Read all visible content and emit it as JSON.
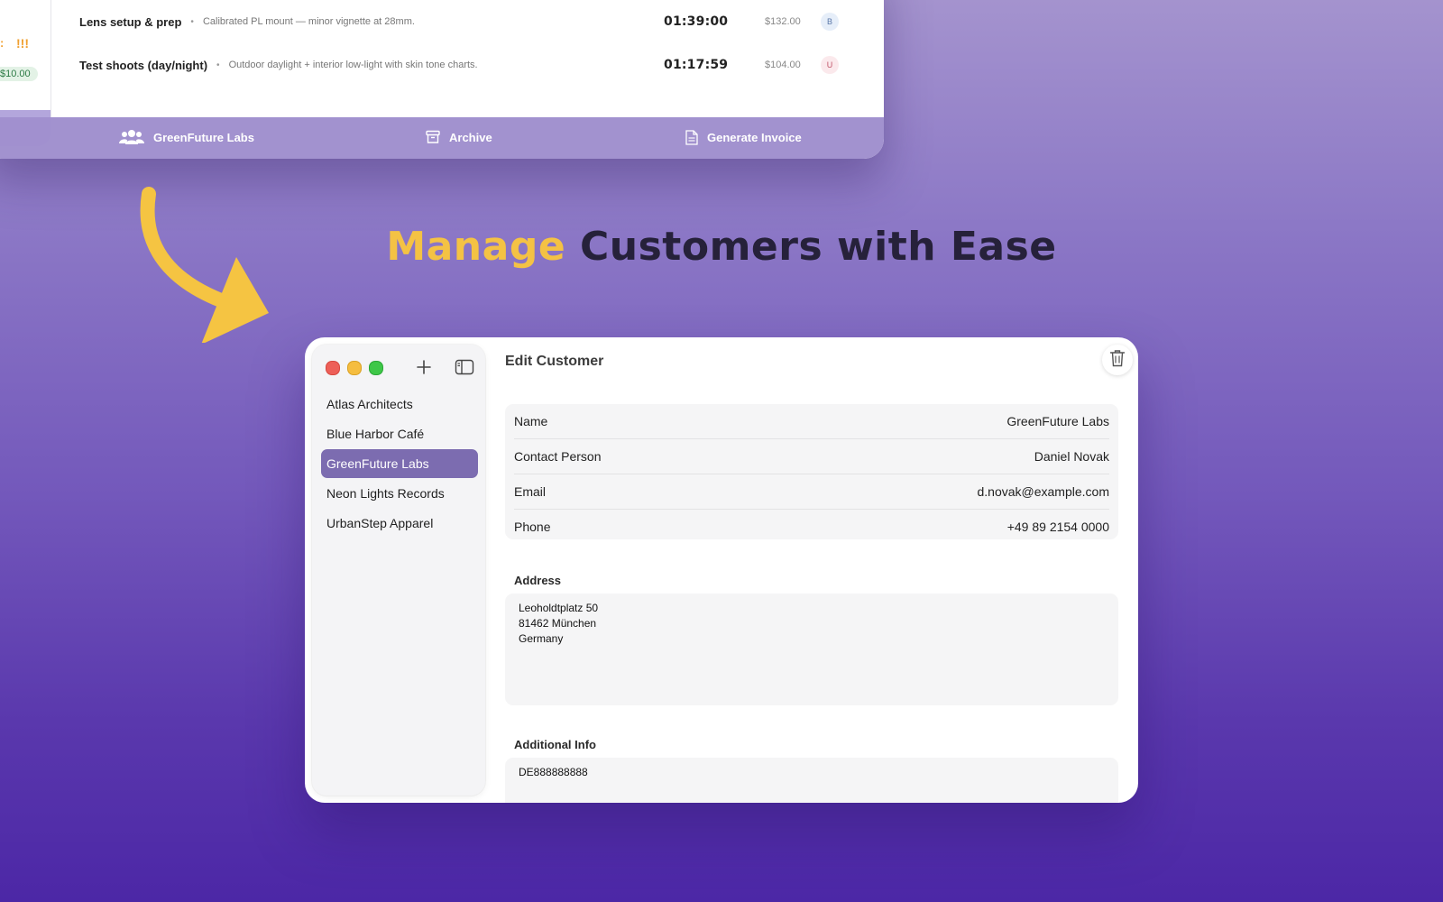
{
  "top_window": {
    "stub": {
      "marks": "!!!",
      "dot": ":",
      "amount": "$10.00"
    },
    "entries": [
      {
        "title": "Lens setup & prep",
        "desc": "Calibrated PL mount — minor vignette at 28mm.",
        "duration": "01:39:00",
        "price": "$132.00",
        "badge": "B"
      },
      {
        "title": "Test shoots (day/night)",
        "desc": "Outdoor daylight + interior low-light with skin tone charts.",
        "duration": "01:17:59",
        "price": "$104.00",
        "badge": "U"
      }
    ],
    "separator": "•",
    "toolbar": {
      "customer_label": "GreenFuture Labs",
      "archive_label": "Archive",
      "invoice_label": "Generate Invoice"
    }
  },
  "headline": {
    "accent": "Manage",
    "rest": "Customers with Ease"
  },
  "colors": {
    "accent": "#f4c244",
    "selection": "#7c6cb0",
    "background_top": "#a493ce",
    "background_bottom": "#4c27a6"
  },
  "main_window": {
    "title": "Edit Customer",
    "customers": [
      {
        "name": "Atlas Architects",
        "selected": false
      },
      {
        "name": "Blue Harbor Café",
        "selected": false
      },
      {
        "name": "GreenFuture Labs",
        "selected": true
      },
      {
        "name": "Neon Lights Records",
        "selected": false
      },
      {
        "name": "UrbanStep Apparel",
        "selected": false
      }
    ],
    "fields": [
      {
        "label": "Name",
        "value": "GreenFuture Labs"
      },
      {
        "label": "Contact Person",
        "value": "Daniel Novak"
      },
      {
        "label": "Email",
        "value": "d.novak@example.com"
      },
      {
        "label": "Phone",
        "value": "+49 89 2154 0000"
      }
    ],
    "address_label": "Address",
    "address_value": "Leoholdtplatz 50\n81462 München\nGermany",
    "additional_label": "Additional Info",
    "additional_value": "DE888888888"
  }
}
